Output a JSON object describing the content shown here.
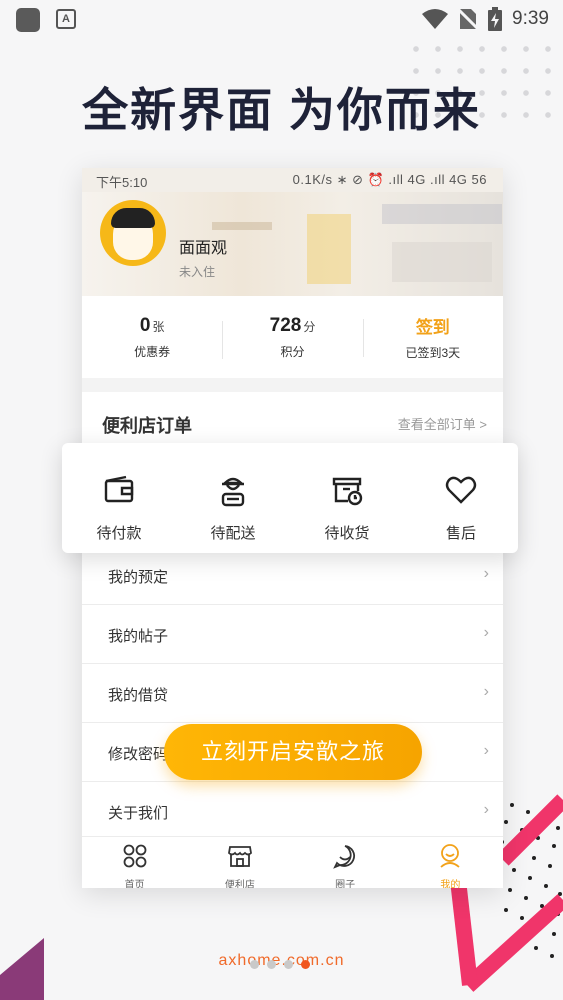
{
  "system_bar": {
    "time": "9:39",
    "app_icon_letter": "A"
  },
  "headline": "全新界面  为你而来",
  "phone": {
    "status_left": "下午5:10",
    "status_right": "0.1K/s ∗ ⊘ ⏰ .ıll 4G .ıll 4G  56",
    "user": {
      "name": "面面观",
      "status": "未入住"
    },
    "stats": [
      {
        "value": "0",
        "unit": "张",
        "label": "优惠券"
      },
      {
        "value": "728",
        "unit": "分",
        "label": "积分"
      },
      {
        "value": "签到",
        "unit": "",
        "label": "已签到3天"
      }
    ],
    "orders": {
      "title": "便利店订单",
      "view_all": "查看全部订单 >"
    },
    "menu": [
      {
        "label": "我的预定"
      },
      {
        "label": "我的帖子"
      },
      {
        "label": "我的借贷"
      },
      {
        "label": "修改密码"
      },
      {
        "label": "关于我们"
      }
    ],
    "tabs": [
      {
        "label": "首页",
        "icon": "home-grid-icon"
      },
      {
        "label": "便利店",
        "icon": "store-icon"
      },
      {
        "label": "圈子",
        "icon": "chat-bubble-icon"
      },
      {
        "label": "我的",
        "icon": "profile-icon"
      }
    ]
  },
  "order_status": [
    {
      "label": "待付款",
      "icon": "wallet-icon"
    },
    {
      "label": "待配送",
      "icon": "courier-icon"
    },
    {
      "label": "待收货",
      "icon": "package-clock-icon"
    },
    {
      "label": "售后",
      "icon": "heart-icon"
    }
  ],
  "cta_label": "立刻开启安歆之旅",
  "watermark": "axhome.com.cn",
  "colors": {
    "accent": "#f6a400",
    "headline": "#1e2238",
    "pink": "#f0356a",
    "purple": "#8a3a78"
  }
}
